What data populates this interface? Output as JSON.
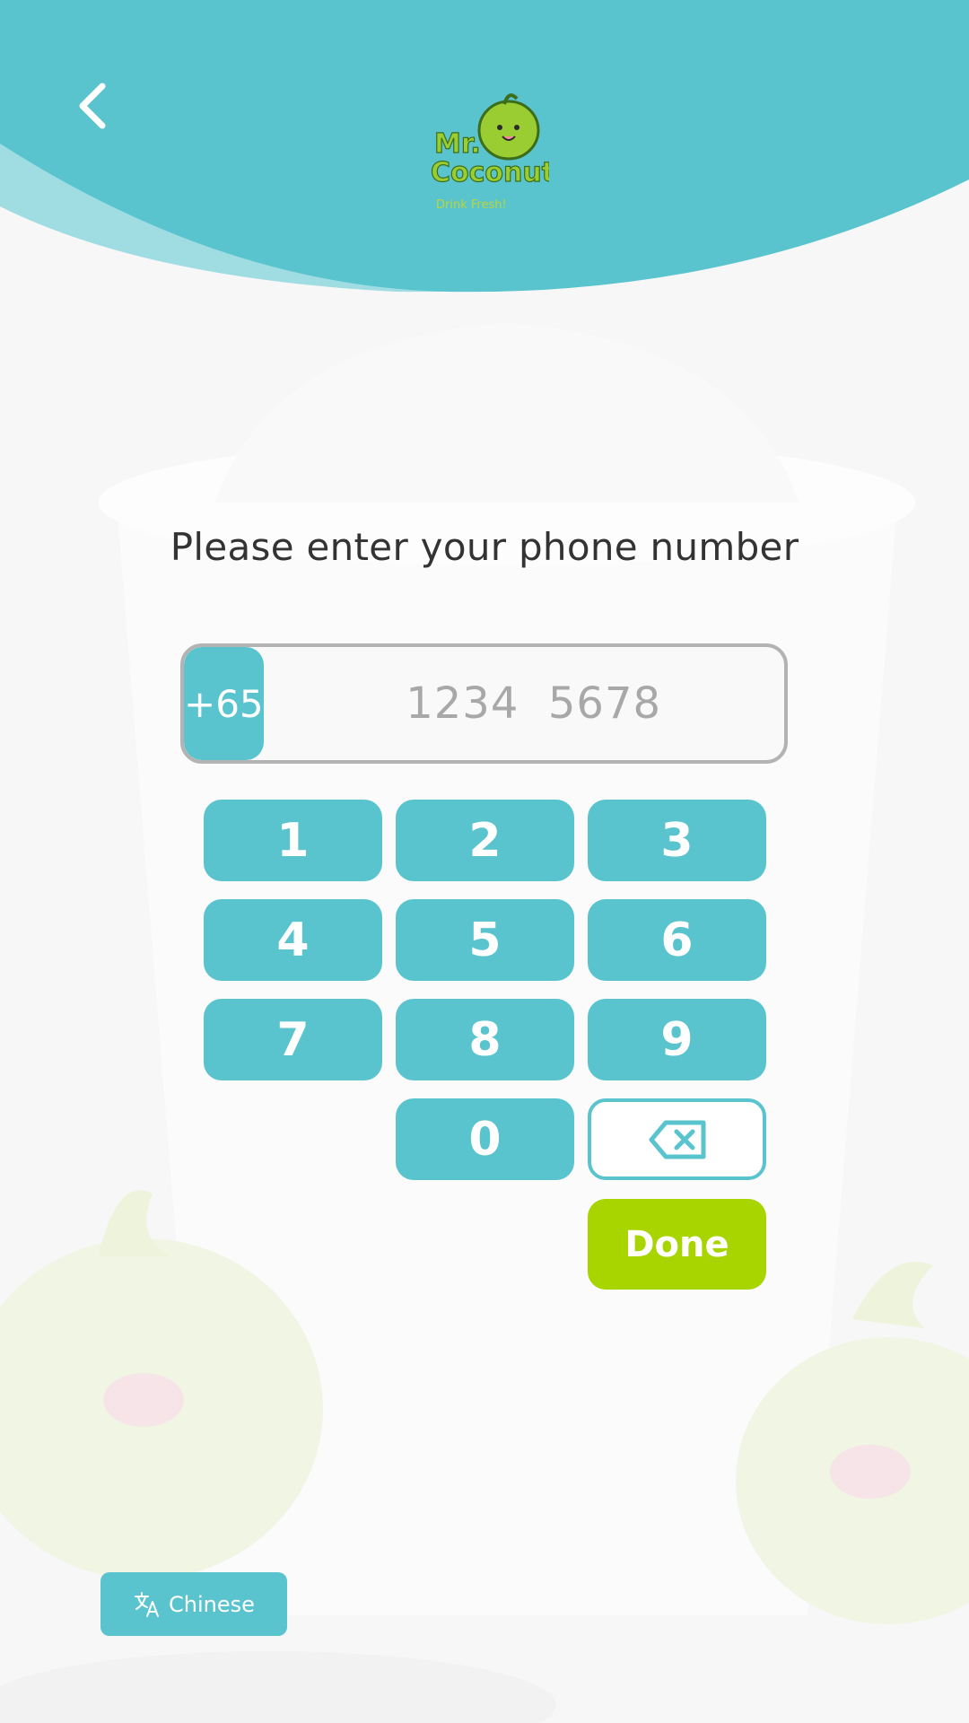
{
  "header": {
    "logo_line1": "Mr.",
    "logo_line2": "Coconut",
    "logo_tagline": "Drink Fresh!"
  },
  "prompt": "Please enter your phone number",
  "phone": {
    "country_code": "+65",
    "placeholder": "1234  5678",
    "value": ""
  },
  "keypad": {
    "keys": [
      "1",
      "2",
      "3",
      "4",
      "5",
      "6",
      "7",
      "8",
      "9",
      "0"
    ],
    "done_label": "Done"
  },
  "language_button": {
    "label": "Chinese",
    "icon": "translate-icon"
  },
  "colors": {
    "primary": "#5ac4ce",
    "accent": "#a8d400",
    "background": "#f7f7f7"
  }
}
